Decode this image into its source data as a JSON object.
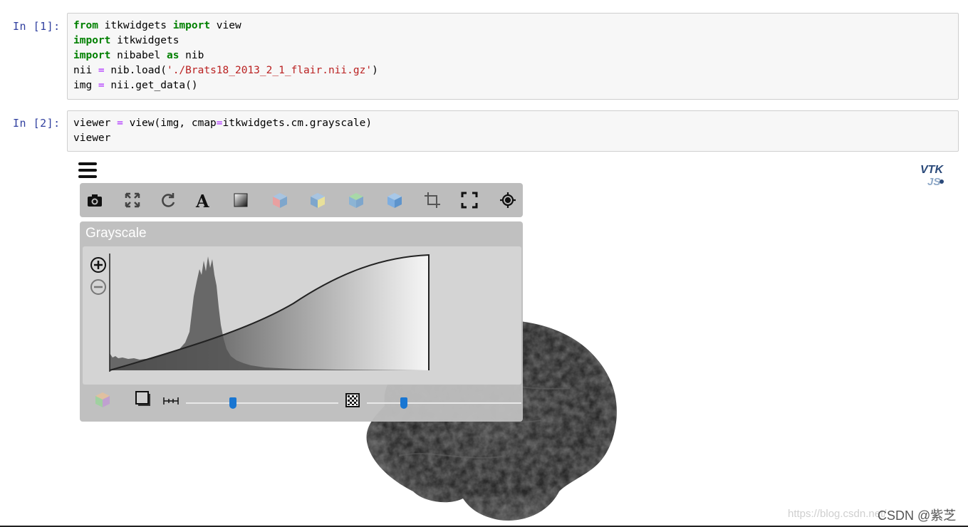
{
  "cells": [
    {
      "prompt": "In  [1]:",
      "lines": [
        [
          {
            "t": "from",
            "c": "kw"
          },
          {
            "t": " itkwidgets ",
            "c": ""
          },
          {
            "t": "import",
            "c": "kw"
          },
          {
            "t": " view",
            "c": ""
          }
        ],
        [
          {
            "t": "import",
            "c": "kw"
          },
          {
            "t": " itkwidgets",
            "c": ""
          }
        ],
        [
          {
            "t": "import",
            "c": "kw"
          },
          {
            "t": " nibabel ",
            "c": ""
          },
          {
            "t": "as",
            "c": "kw"
          },
          {
            "t": " nib",
            "c": ""
          }
        ],
        [
          {
            "t": "nii ",
            "c": ""
          },
          {
            "t": "=",
            "c": "op"
          },
          {
            "t": " nib.load(",
            "c": ""
          },
          {
            "t": "'./Brats18_2013_2_1_flair.nii.gz'",
            "c": "str"
          },
          {
            "t": ")",
            "c": ""
          }
        ],
        [
          {
            "t": "img ",
            "c": ""
          },
          {
            "t": "=",
            "c": "op"
          },
          {
            "t": " nii.get_data()",
            "c": ""
          }
        ]
      ]
    },
    {
      "prompt": "In  [2]:",
      "lines": [
        [
          {
            "t": "viewer ",
            "c": ""
          },
          {
            "t": "=",
            "c": "op"
          },
          {
            "t": " view(img, cmap",
            "c": ""
          },
          {
            "t": "=",
            "c": "op"
          },
          {
            "t": "itkwidgets.cm.grayscale)",
            "c": ""
          }
        ],
        [
          {
            "t": "viewer",
            "c": ""
          }
        ]
      ]
    }
  ],
  "viewer": {
    "colormap_title": "Grayscale",
    "logo_text_top": "VTK",
    "logo_text_bottom": "JS",
    "toolbar_icons": [
      "camera-icon",
      "fullscreen-icon",
      "reset-rotate-icon",
      "annotation-text-icon",
      "interpolation-icon",
      "view-x-icon",
      "view-y-icon",
      "view-z-icon",
      "view-3d-icon",
      "crop-icon",
      "fit-screen-icon",
      "reset-camera-icon"
    ],
    "gradient_opacity_level": 0.31,
    "sample_distance_level": 0.24
  },
  "watermark": {
    "url": "https://blog.csdn.net/",
    "text": "CSDN @紫芝"
  }
}
